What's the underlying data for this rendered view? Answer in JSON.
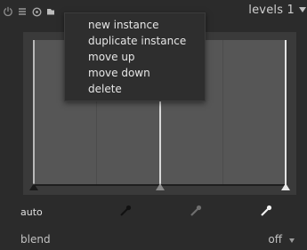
{
  "header": {
    "module_title": "levels 1",
    "icons": [
      "power-icon",
      "presets-icon",
      "reset-icon",
      "instance-icon",
      "collapse-arrow-icon"
    ]
  },
  "graph": {
    "black_point": 0.0,
    "grey_point": 0.5,
    "white_point": 1.0
  },
  "pickers": {
    "auto_label": "auto",
    "icons": [
      "black-picker-icon",
      "grey-picker-icon",
      "white-picker-icon"
    ]
  },
  "blend": {
    "label": "blend",
    "value": "off"
  },
  "instance_menu": {
    "items": [
      {
        "label": "new instance"
      },
      {
        "label": "duplicate instance"
      },
      {
        "label": "move up"
      },
      {
        "label": "move down"
      },
      {
        "label": "delete"
      }
    ]
  },
  "colors": {
    "background": "#2b2b2b",
    "graph_area": "#565656",
    "graph_frame": "#3a3a3a",
    "menu_background": "#2e2e2e"
  }
}
